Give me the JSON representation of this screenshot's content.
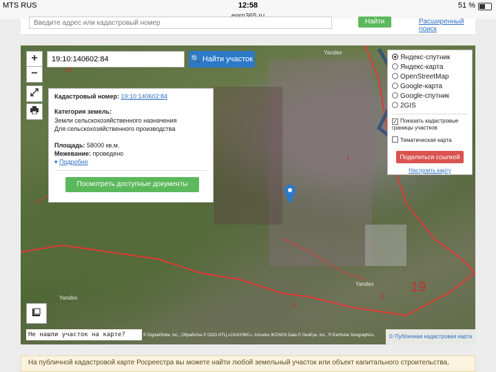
{
  "statusbar": {
    "carrier": "MTS RUS",
    "time": "12:58",
    "battery": "51 %"
  },
  "browser": {
    "url": "egrp365.ru"
  },
  "top_form": {
    "placeholder": "Введите адрес или кадастровый номер",
    "find_label": "Найти",
    "advanced_label": "Расширенный поиск"
  },
  "map": {
    "search_value": "19:10:140602:84",
    "search_button": "Найти участок",
    "zoom_in": "+",
    "zoom_out": "−",
    "labels": {
      "n10": "10",
      "n1": "1",
      "n4a": "4",
      "n4b": "4",
      "n19": "19",
      "yandex1": "Yandex",
      "yandex2": "Yandex",
      "yandex3": "Yandex"
    },
    "not_found": "Не нашли участок на карте?",
    "attribution": "© DigitalGlobe, Inc., Обработка © ООО ИТЦ «СКАНЭКС», Includes IKONOS Data © GeoEye, Inc., © Earthstar Geographics",
    "pkk_link": "© Публичная кадастровая карта"
  },
  "info": {
    "cad_label": "Кадастровый номер:",
    "cad_value": "19:10:140602:84",
    "category_label": "Категория земель:",
    "category_line1": "Земли сельскохозяйственного назначения",
    "category_line2": "Для сельскохозяйственного производства",
    "area_label": "Площадь:",
    "area_value": "58000 кв.м.",
    "survey_label": "Межевание:",
    "survey_value": "проведено",
    "details_link": "Подробно",
    "docs_button": "Посмотреть доступные документы"
  },
  "layers": {
    "options": [
      "Яндекс-спутник",
      "Яндекс-карта",
      "OpenStreetMap",
      "Google-карта",
      "Google-спутник",
      "2GIS"
    ],
    "selected_index": 0,
    "show_borders": "Показать кадастровые границы участков",
    "thematic": "Тематическая карта",
    "share_button": "Поделиться ссылкой",
    "setup_link": "Настроить карту"
  },
  "footer": {
    "note": "На публичной кадастровой карте Росреестра вы можете найти любой земельный участок или объект капитального строительства,"
  },
  "colors": {
    "accent": "#2c79c8",
    "green": "#5cb85c",
    "red": "#d9534f",
    "boundary": "#e03a35"
  },
  "icons": {
    "fullscreen": "expand-icon",
    "print": "printer-icon",
    "search": "search-icon",
    "marker": "map-marker-icon",
    "layers_toggle": "layers-icon"
  }
}
